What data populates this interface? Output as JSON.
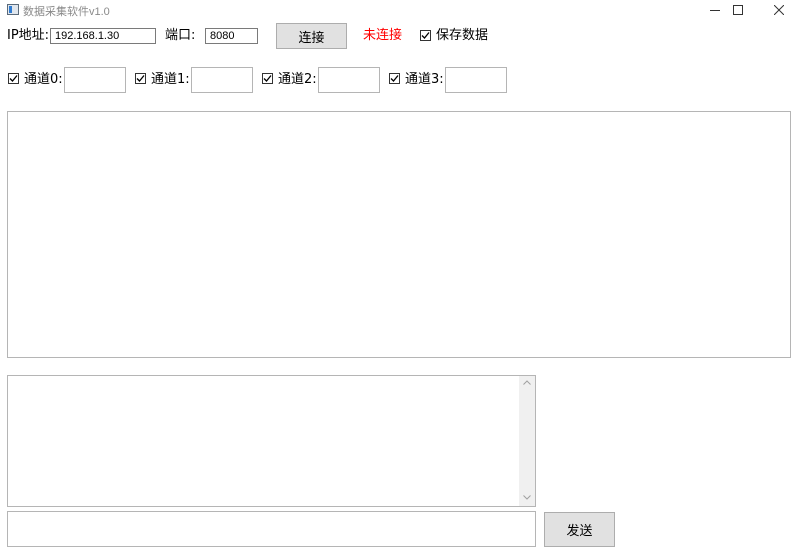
{
  "window": {
    "title": "数据采集软件v1.0"
  },
  "connection": {
    "ip_label": "IP地址:",
    "ip_value": "192.168.1.30",
    "port_label": "端口:",
    "port_value": "8080",
    "connect_button": "连接",
    "status_text": "未连接",
    "status_color": "#ff0000",
    "save_data_label": "保存数据",
    "save_data_checked": true
  },
  "channels": [
    {
      "label": "通道0:",
      "checked": true,
      "value": ""
    },
    {
      "label": "通道1:",
      "checked": true,
      "value": ""
    },
    {
      "label": "通道2:",
      "checked": true,
      "value": ""
    },
    {
      "label": "通道3:",
      "checked": true,
      "value": ""
    }
  ],
  "send": {
    "input_value": "",
    "button_label": "发送"
  },
  "icons": {
    "minimize": "minimize-icon",
    "maximize": "maximize-icon",
    "close": "close-icon",
    "check": "check-icon"
  }
}
